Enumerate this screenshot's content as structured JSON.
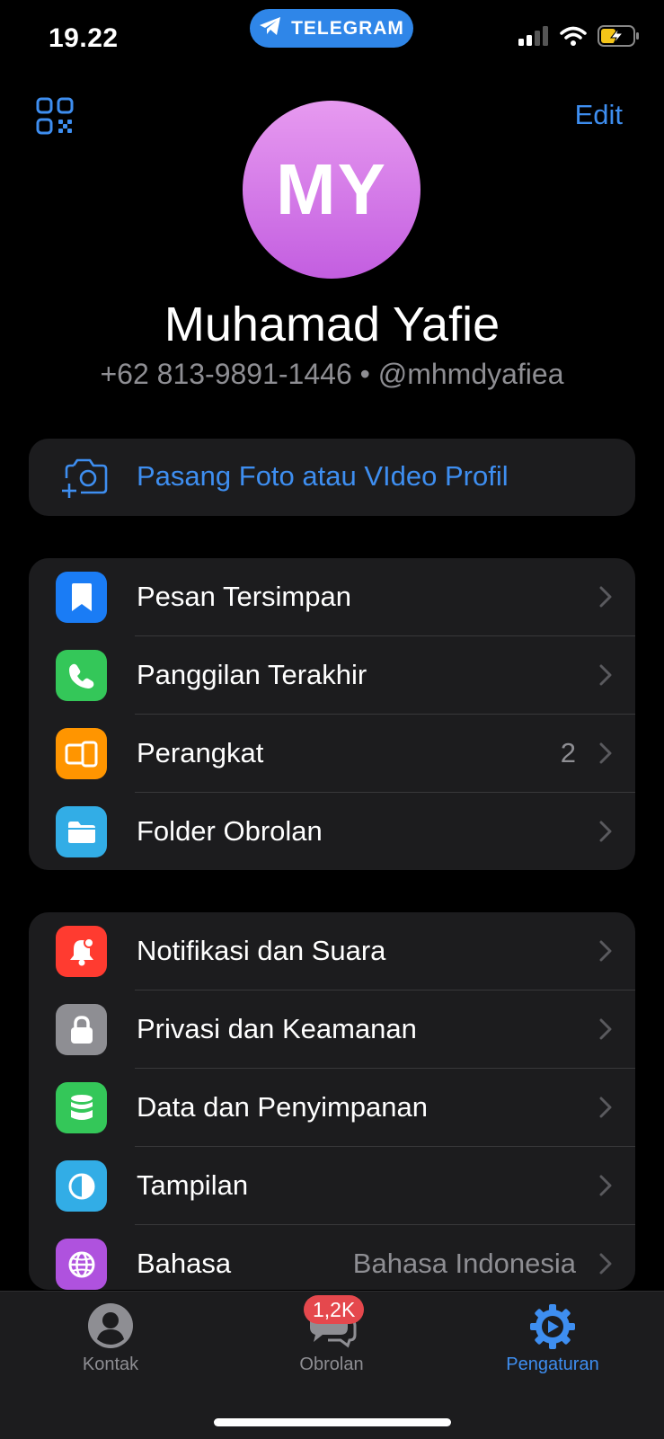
{
  "status_bar": {
    "time": "19.22",
    "app_pill": "TELEGRAM"
  },
  "header": {
    "edit_label": "Edit"
  },
  "profile": {
    "initials": "MY",
    "name": "Muhamad Yafie",
    "phone": "+62 813-9891-1446",
    "separator": "•",
    "username": "@mhmdyafiea"
  },
  "photo_action": {
    "label": "Pasang Foto atau VIdeo Profil"
  },
  "group1": [
    {
      "label": "Pesan Tersimpan",
      "value": "",
      "icon": "bookmark-icon",
      "color": "#1a7cf5"
    },
    {
      "label": "Panggilan Terakhir",
      "value": "",
      "icon": "phone-icon",
      "color": "#34c759"
    },
    {
      "label": "Perangkat",
      "value": "2",
      "icon": "devices-icon",
      "color": "#ff9500"
    },
    {
      "label": "Folder Obrolan",
      "value": "",
      "icon": "folder-icon",
      "color": "#32ade6"
    }
  ],
  "group2": [
    {
      "label": "Notifikasi dan Suara",
      "value": "",
      "icon": "bell-icon",
      "color": "#ff3b30"
    },
    {
      "label": "Privasi dan Keamanan",
      "value": "",
      "icon": "lock-icon",
      "color": "#8e8e93"
    },
    {
      "label": "Data dan Penyimpanan",
      "value": "",
      "icon": "database-icon",
      "color": "#34c759"
    },
    {
      "label": "Tampilan",
      "value": "",
      "icon": "appearance-icon",
      "color": "#32ade6"
    },
    {
      "label": "Bahasa",
      "value": "Bahasa Indonesia",
      "icon": "globe-icon",
      "color": "#af52de"
    }
  ],
  "tabbar": {
    "contacts": "Kontak",
    "chats": "Obrolan",
    "chats_badge": "1,2K",
    "settings": "Pengaturan"
  },
  "colors": {
    "accent": "#3e8ef0",
    "badge": "#e5484d"
  }
}
